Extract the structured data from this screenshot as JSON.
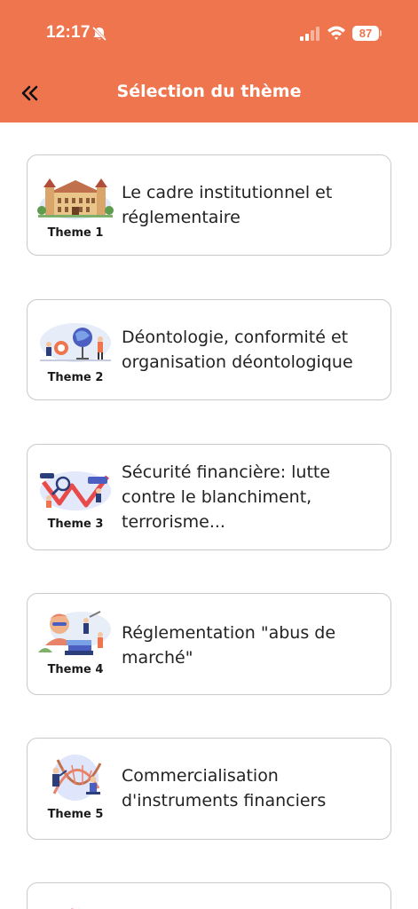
{
  "status_bar": {
    "time": "12:17",
    "battery": "87",
    "icons": [
      "bell-muted-icon",
      "signal-icon",
      "wifi-icon",
      "battery-icon"
    ]
  },
  "header": {
    "title": "Sélection du thème",
    "back_icon": "double-chevron-left-icon",
    "background_color": "#EE754E"
  },
  "themes": [
    {
      "label": "Theme 1",
      "title": "Le cadre institutionnel et réglementaire"
    },
    {
      "label": "Theme 2",
      "title": "Déontologie, conformité et organisation déontologique"
    },
    {
      "label": "Theme 3",
      "title": "Sécurité financière: lutte contre le blanchiment, terrorisme..."
    },
    {
      "label": "Theme 4",
      "title": "Réglementation \"abus de marché\""
    },
    {
      "label": "Theme 5",
      "title": "Commercialisation d'instruments financiers"
    }
  ]
}
